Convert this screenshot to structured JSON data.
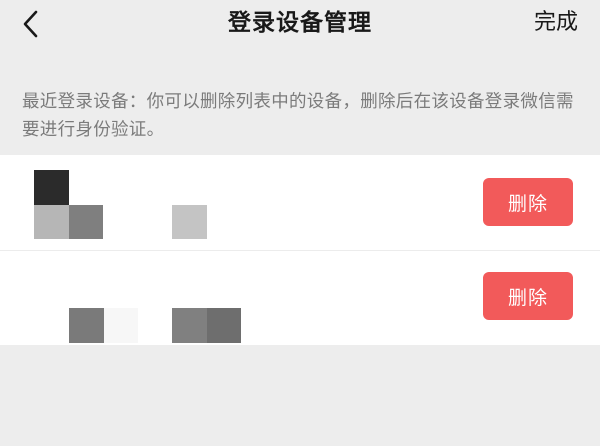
{
  "header": {
    "title": "登录设备管理",
    "done_label": "完成",
    "back_icon": "chevron-left-icon"
  },
  "notice": {
    "text": "最近登录设备：你可以删除列表中的设备，删除后在该设备登录微信需要进行身份验证。"
  },
  "devices": [
    {
      "name_obscured": true,
      "delete_label": "删除"
    },
    {
      "name_obscured": true,
      "delete_label": "删除"
    }
  ],
  "colors": {
    "background": "#ededed",
    "card": "#ffffff",
    "delete_button": "#f25a5a",
    "notice_text": "#7b7b7b",
    "primary_text": "#191919"
  }
}
